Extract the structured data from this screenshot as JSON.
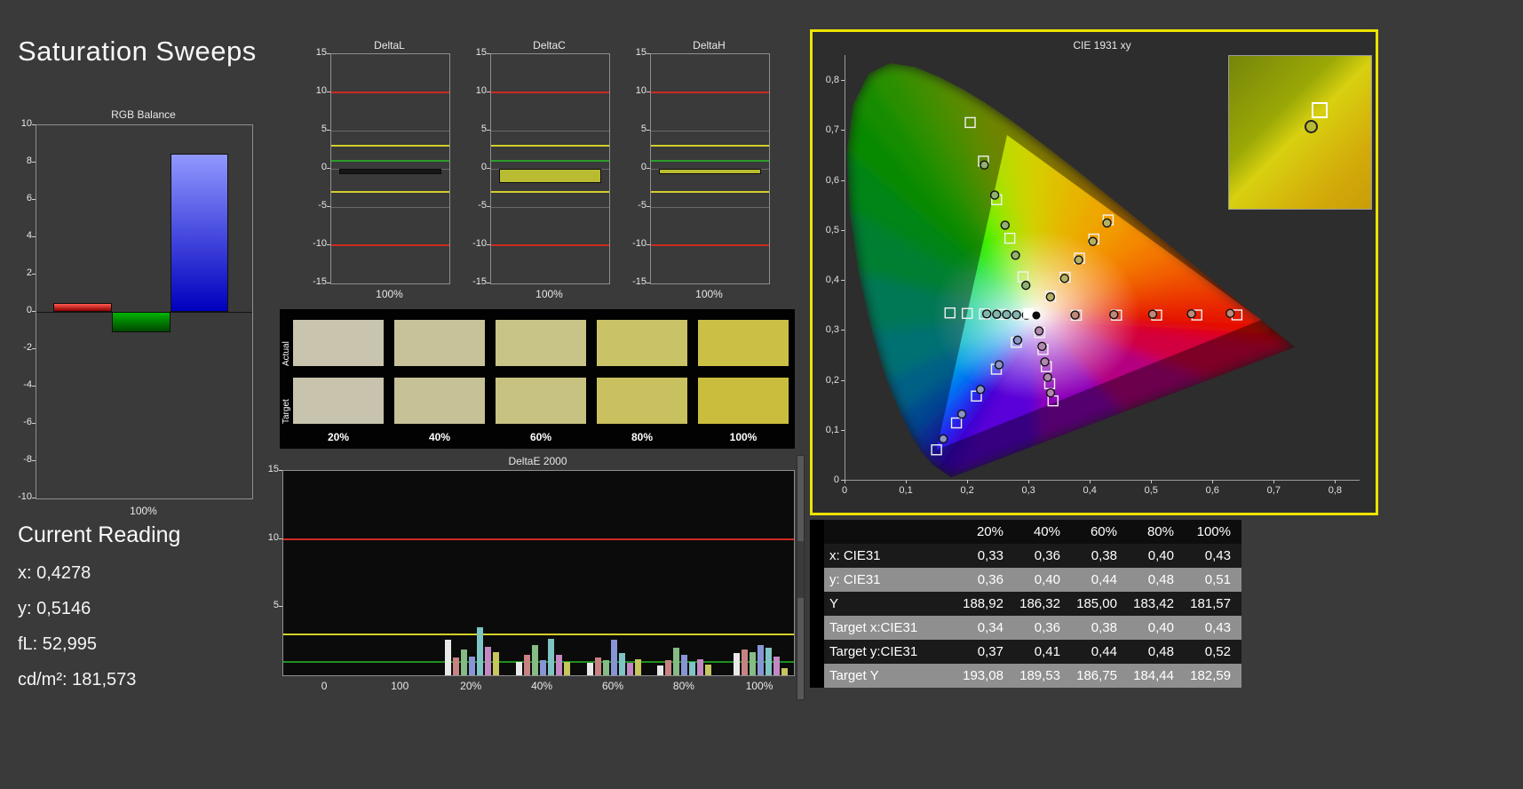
{
  "app": {
    "title": "Saturation Sweeps"
  },
  "colors": {
    "background": "#3a3a3a",
    "selected_panel_border": "#ece300",
    "limit_red": "#cf2a20",
    "limit_yellow": "#d3cf2a",
    "limit_green": "#2a9e2a",
    "plot_border": "#8f8f8f",
    "deltae_plot_bg": "#0b0b0b"
  },
  "current_reading": {
    "heading": "Current Reading",
    "lines": [
      "x: 0,4278",
      "y: 0,5146",
      "fL: 52,995",
      "cd/m²: 181,573"
    ]
  },
  "rgb_balance": {
    "title": "RGB Balance",
    "x_label": "100%",
    "chart_data": {
      "type": "bar",
      "categories": [
        "Red",
        "Green",
        "Blue"
      ],
      "values": [
        0.5,
        -1.1,
        8.5
      ],
      "ylim": [
        -10,
        10
      ],
      "yticks": [
        10,
        8,
        6,
        4,
        2,
        0,
        -2,
        -4,
        -6,
        -8,
        -10
      ],
      "bar_gradients": {
        "Red": [
          "#ff5a50",
          "#8c0000"
        ],
        "Green": [
          "#00b400",
          "#004600"
        ],
        "Blue": [
          "#9098ff",
          "#0000be"
        ]
      }
    }
  },
  "delta_charts": {
    "x_label": "100%",
    "ylim": [
      -15,
      15
    ],
    "yticks": [
      15,
      10,
      5,
      0,
      -5,
      -10,
      -15
    ],
    "limit_lines": {
      "red": [
        10,
        -10
      ],
      "yellow": [
        3,
        -3
      ],
      "green": [
        1
      ]
    },
    "charts": [
      {
        "title": "DeltaL",
        "value": -0.7,
        "bar_color": "#161616"
      },
      {
        "title": "DeltaC",
        "value": -1.9,
        "bar_color": "#b9bb31"
      },
      {
        "title": "DeltaH",
        "value": -0.7,
        "bar_color": "#b9bb31"
      }
    ]
  },
  "swatches": {
    "row_labels": [
      "Actual",
      "Target"
    ],
    "col_labels": [
      "20%",
      "40%",
      "60%",
      "80%",
      "100%"
    ],
    "actual_colors": [
      "#c8c4ae",
      "#c7c29a",
      "#c8c386",
      "#cac266",
      "#ccbf45"
    ],
    "target_colors": [
      "#c7c3ad",
      "#c6c197",
      "#c8c282",
      "#c9c05f",
      "#cabd3e"
    ]
  },
  "deltae": {
    "title": "DeltaE 2000",
    "ylim": [
      0,
      15
    ],
    "yticks": [
      15,
      10,
      5
    ],
    "limit_lines": {
      "red": 10,
      "yellow": 3,
      "green": 1
    },
    "x_labels": [
      {
        "text": "0",
        "pos": 0.082
      },
      {
        "text": "100",
        "pos": 0.23
      },
      {
        "text": "20%",
        "pos": 0.369
      },
      {
        "text": "40%",
        "pos": 0.508
      },
      {
        "text": "60%",
        "pos": 0.647
      },
      {
        "text": "80%",
        "pos": 0.786
      },
      {
        "text": "100%",
        "pos": 0.934
      }
    ],
    "chart_data": {
      "type": "bar",
      "series_colors": [
        "#e9e9e9",
        "#c98282",
        "#85bb85",
        "#8795d5",
        "#7fc4c4",
        "#c387c3",
        "#c6c65e"
      ],
      "groups": [
        {
          "label": "20%",
          "pos": 0.369,
          "values": [
            2.6,
            1.3,
            1.9,
            1.4,
            3.5,
            2.1,
            1.7
          ]
        },
        {
          "label": "40%",
          "pos": 0.508,
          "values": [
            1.0,
            1.5,
            2.2,
            1.1,
            2.7,
            1.5,
            1.0
          ]
        },
        {
          "label": "60%",
          "pos": 0.647,
          "values": [
            0.9,
            1.3,
            1.1,
            2.6,
            1.6,
            0.9,
            1.2
          ]
        },
        {
          "label": "80%",
          "pos": 0.786,
          "values": [
            0.7,
            1.1,
            2.0,
            1.5,
            1.0,
            1.2,
            0.8
          ]
        },
        {
          "label": "100%",
          "pos": 0.934,
          "values": [
            1.6,
            1.9,
            1.7,
            2.2,
            2.0,
            1.4,
            0.5
          ]
        }
      ]
    }
  },
  "cie": {
    "title": "CIE 1931 xy",
    "x_ticks": [
      "0",
      "0,1",
      "0,2",
      "0,3",
      "0,4",
      "0,5",
      "0,6",
      "0,7",
      "0,8"
    ],
    "y_ticks": [
      "0",
      "0,1",
      "0,2",
      "0,3",
      "0,4",
      "0,5",
      "0,6",
      "0,7",
      "0,8"
    ],
    "white_point": [
      0.3127,
      0.329
    ],
    "gamut_triangle": [
      [
        0.68,
        0.32
      ],
      [
        0.265,
        0.69
      ],
      [
        0.15,
        0.06
      ]
    ],
    "saturation_steps": [
      0.2,
      0.4,
      0.6,
      0.8,
      1.0
    ],
    "sweeps": [
      {
        "name": "red",
        "target_end": [
          0.64,
          0.33
        ],
        "measured_end": [
          0.629,
          0.333
        ],
        "dot_color": "#bc8a7a"
      },
      {
        "name": "green",
        "target_end": [
          0.205,
          0.715
        ],
        "measured_end": [
          0.228,
          0.63
        ],
        "dot_color": "#92b072"
      },
      {
        "name": "blue",
        "target_end": [
          0.15,
          0.06
        ],
        "measured_end": [
          0.161,
          0.082
        ],
        "dot_color": "#8a94c6"
      },
      {
        "name": "cyan",
        "target_end": [
          0.172,
          0.334
        ],
        "measured_end": [
          0.232,
          0.332
        ],
        "dot_color": "#86b4ae"
      },
      {
        "name": "magenta",
        "target_end": [
          0.34,
          0.158
        ],
        "measured_end": [
          0.336,
          0.174
        ],
        "dot_color": "#b288ae"
      },
      {
        "name": "yellow",
        "target_end": [
          0.43,
          0.52
        ],
        "measured_end": [
          0.428,
          0.514
        ],
        "dot_color": "#b4b162"
      }
    ],
    "selected_point": [
      0.3,
      0.333
    ]
  },
  "results_table": {
    "col_headers": [
      "20%",
      "40%",
      "60%",
      "80%",
      "100%"
    ],
    "rows": [
      {
        "label": "x: CIE31",
        "values": [
          "0,33",
          "0,36",
          "0,38",
          "0,40",
          "0,43"
        ]
      },
      {
        "label": "y: CIE31",
        "values": [
          "0,36",
          "0,40",
          "0,44",
          "0,48",
          "0,51"
        ]
      },
      {
        "label": "Y",
        "values": [
          "188,92",
          "186,32",
          "185,00",
          "183,42",
          "181,57"
        ]
      },
      {
        "label": "Target x:CIE31",
        "values": [
          "0,34",
          "0,36",
          "0,38",
          "0,40",
          "0,43"
        ]
      },
      {
        "label": "Target y:CIE31",
        "values": [
          "0,37",
          "0,41",
          "0,44",
          "0,48",
          "0,52"
        ]
      },
      {
        "label": "Target Y",
        "values": [
          "193,08",
          "189,53",
          "186,75",
          "184,44",
          "182,59"
        ]
      }
    ]
  }
}
